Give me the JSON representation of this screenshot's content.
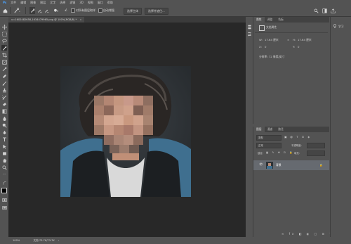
{
  "menu": [
    "文件",
    "编辑",
    "图像",
    "图层",
    "文字",
    "选择",
    "滤镜",
    "3D",
    "视图",
    "窗口",
    "帮助"
  ],
  "options": {
    "sample_all_layers": "对所有图层取样",
    "auto_enhance": "自动增强",
    "select_subject": "选择主体",
    "select_and_mask": "选择并遮住..."
  },
  "document": {
    "tab_label": "u=1602482658,1634479965.png @ 100%(RGB/8) *",
    "close_glyph": "×"
  },
  "status": {
    "zoom": "100%",
    "doc_info": "文档:73.7K/73.7K"
  },
  "properties_panel": {
    "tabs": [
      "属性",
      "调整",
      "色板"
    ],
    "doc_label": "文档属性",
    "w_label": "W:",
    "w_value": "17.64 厘米",
    "h_label": "H:",
    "h_value": "17.64 厘米",
    "x_label": "X:",
    "x_value": "0",
    "y_label": "Y:",
    "y_value": "0",
    "resolution": "分辨率: 72 像素/英寸"
  },
  "layers_panel": {
    "tabs": [
      "图层",
      "通道",
      "路径"
    ],
    "kind_placeholder": "类型",
    "blend_mode": "正常",
    "opacity_label": "不透明度:",
    "lock_label": "锁定:",
    "fill_label": "填充:",
    "layer_name": "背景"
  },
  "learn_panel": {
    "title": "学习"
  },
  "icon_colors": {
    "workspace": "#282828",
    "panel": "#535353",
    "selected_layer": "#666a70"
  }
}
